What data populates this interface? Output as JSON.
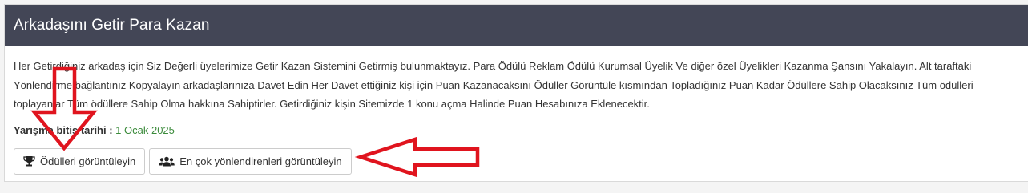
{
  "panel": {
    "title": "Arkadaşını Getir Para Kazan",
    "description": "Her Getirdiğiniz arkadaş için Siz Değerli üyelerimize Getir Kazan Sistemini Getirmiş bulunmaktayız. Para Ödülü Reklam Ödülü Kurumsal Üyelik Ve diğer özel Üyelikleri Kazanma Şansını Yakalayın. Alt taraftaki Yönlendirme bağlantınız Kopyalayın arkadaşlarınıza Davet Edin Her Davet ettiğiniz kişi için Puan Kazanacaksını Ödüller Görüntüle kısmından Topladığınız Puan Kadar Ödüllere Sahip Olacaksınız Tüm ödülleri toplayanlar Tüm ödüllere Sahip Olma hakkına Sahiptirler. Getirdiğiniz kişin Sitemizde 1 konu açma Halinde Puan Hesabınıza Eklenecektir.",
    "deadline_label": "Yarışma bitiş tarihi :",
    "deadline_date": "1 Ocak 2025"
  },
  "buttons": {
    "rewards_label": "Ödülleri görüntüleyin",
    "rewards_icon": "trophy-icon",
    "top_referrers_label": "En çok yönlendirenleri görüntüleyin",
    "top_referrers_icon": "users-icon"
  },
  "colors": {
    "header_bg": "#434656",
    "deadline_date": "#3a8a3a",
    "annotation_arrow": "#e0141e"
  }
}
